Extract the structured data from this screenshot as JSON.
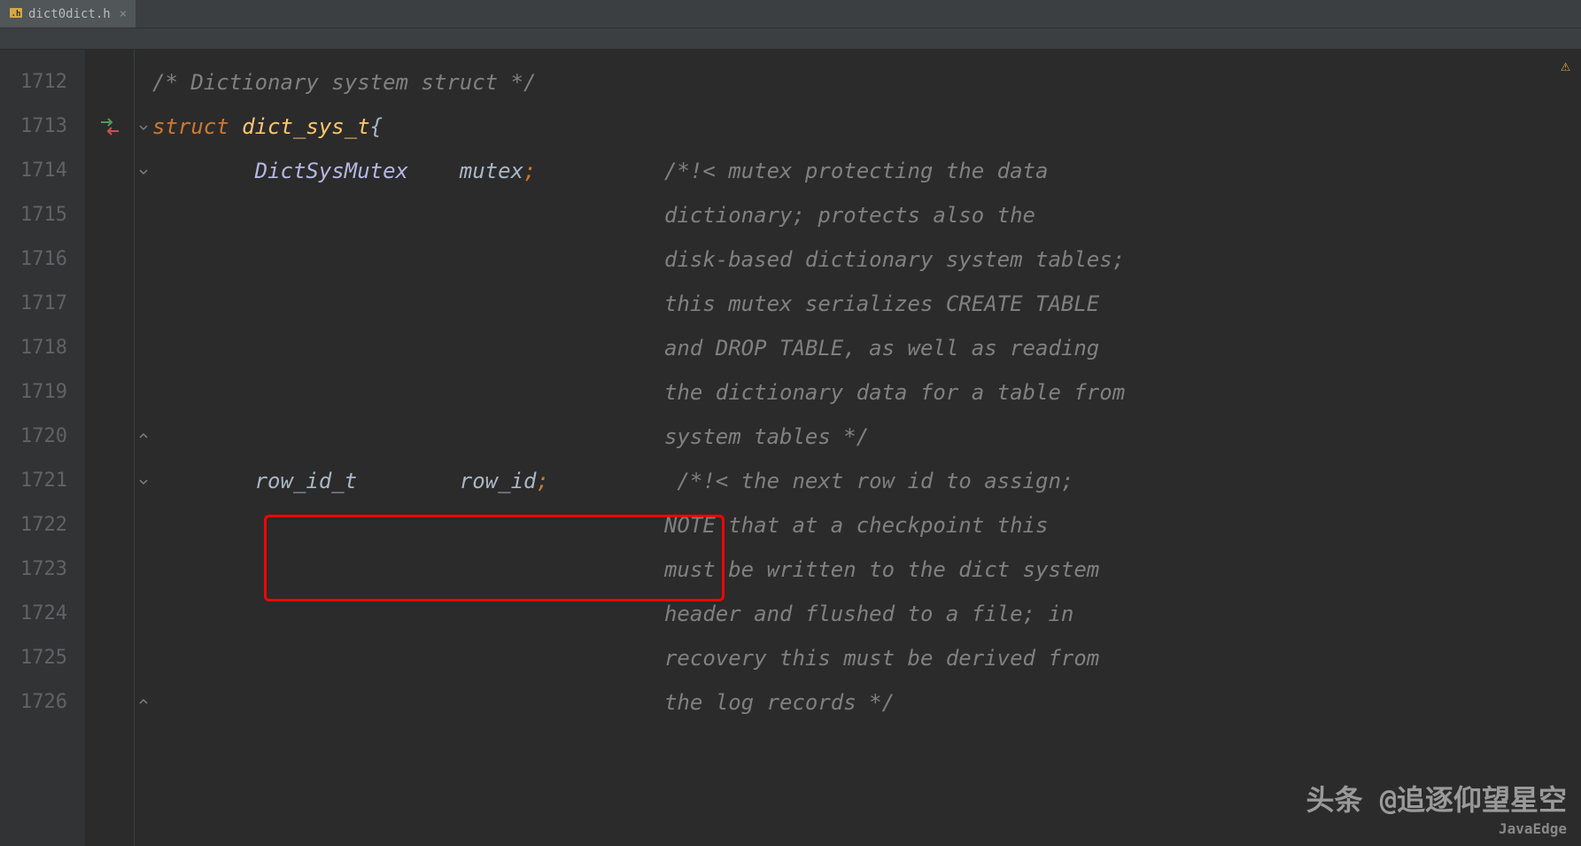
{
  "tab": {
    "icon_label": "H",
    "filename": "dict0dict.h",
    "close_glyph": "×"
  },
  "warning_glyph": "⚠",
  "gutter": {
    "start": 1712,
    "lines": [
      "1712",
      "1713",
      "1714",
      "1715",
      "1716",
      "1717",
      "1718",
      "1719",
      "1720",
      "1721",
      "1722",
      "1723",
      "1724",
      "1725",
      "1726"
    ]
  },
  "code": {
    "l1712": "/* Dictionary system struct */",
    "l1713_kw": "struct",
    "l1713_name": " dict_sys_t",
    "l1713_brace": "{",
    "l1714_type": "        DictSysMutex",
    "l1714_field": "    mutex",
    "l1714_semi": ";",
    "l1714_comment": "          /*!< mutex protecting the data",
    "l1715_comment": "                                        dictionary; protects also the",
    "l1716_comment": "                                        disk-based dictionary system tables;",
    "l1717_comment": "                                        this mutex serializes CREATE TABLE",
    "l1718_comment": "                                        and DROP TABLE, as well as reading",
    "l1719_comment": "                                        the dictionary data for a table from",
    "l1720_comment": "                                        system tables */",
    "l1721_type": "        row_id_t",
    "l1721_field": "        row_id",
    "l1721_semi": ";",
    "l1721_comment": "          /*!< the next row id to assign;",
    "l1722_comment": "                                        NOTE that at a checkpoint this",
    "l1723_comment": "                                        must be written to the dict system",
    "l1724_comment": "                                        header and flushed to a file; in",
    "l1725_comment": "                                        recovery this must be derived from",
    "l1726_comment": "                                        the log records */"
  },
  "watermark": {
    "main": "头条 @追逐仰望星空",
    "sub": "JavaEdge"
  }
}
